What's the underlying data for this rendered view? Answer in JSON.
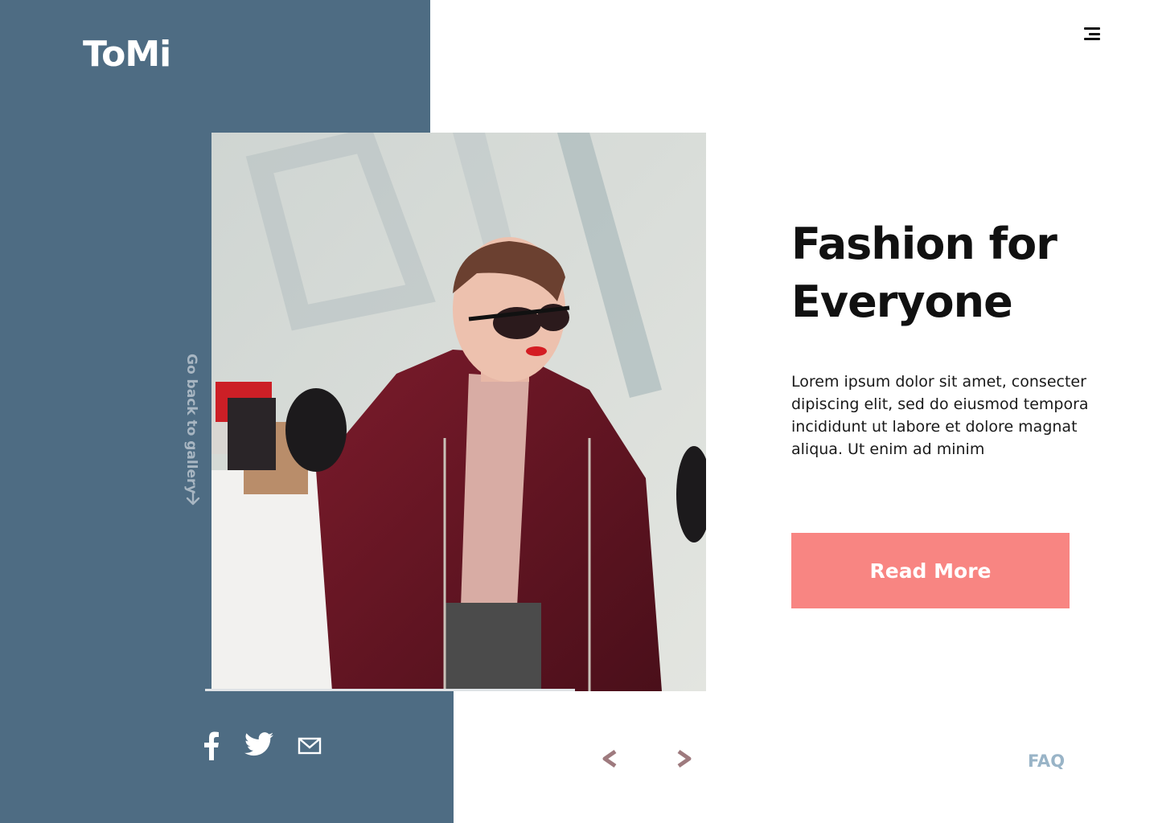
{
  "brand": {
    "logo": "ToMi"
  },
  "header": {
    "menu_icon": "hamburger-menu-icon"
  },
  "sidebar": {
    "gallery_link": "Go back to gallery",
    "arrow_icon": "arrow-down-icon"
  },
  "hero": {
    "headline": "Fashion for Everyone",
    "body": "Lorem ipsum dolor sit amet, consecter dipiscing elit, sed do eiusmod tempora incididunt ut labore et dolore magnat aliqua. Ut enim ad minim",
    "cta_label": "Read More",
    "image_icon": "fashion-photo"
  },
  "social": {
    "icons": [
      "facebook-icon",
      "twitter-icon",
      "mail-icon"
    ]
  },
  "pager": {
    "prev_icon": "chevron-left-icon",
    "next_icon": "chevron-right-icon"
  },
  "footer": {
    "faq_label": "FAQ"
  },
  "colors": {
    "panel": "#4e6c83",
    "accent": "#f88582",
    "faq": "#99b4c7",
    "chevron": "#9e7a7e",
    "gallery_text": "#a8b6c2"
  }
}
